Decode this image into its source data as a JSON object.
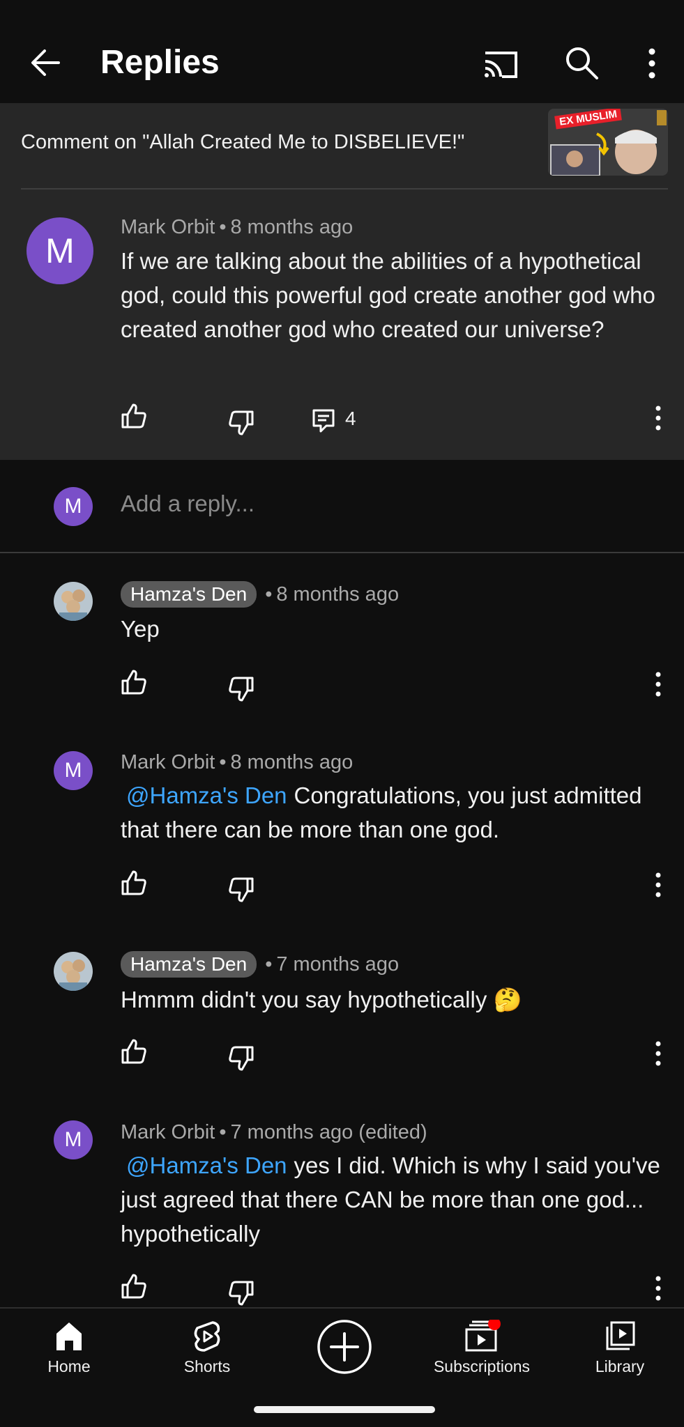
{
  "header": {
    "title": "Replies"
  },
  "context": {
    "comment_on": "Comment on \"Allah Created Me to DISBELIEVE!\"",
    "thumbnail_badge": "EX MUSLIM"
  },
  "main_comment": {
    "avatar_letter": "M",
    "author": "Mark Orbit",
    "time": "8 months ago",
    "text": "If we are talking about the abilities of a hypothetical god, could this powerful god create another god who created another god who created our universe?",
    "reply_count": "4"
  },
  "reply_box": {
    "avatar_letter": "M",
    "placeholder": "Add a reply..."
  },
  "replies": [
    {
      "author": "Hamza's Den",
      "time": "8 months ago",
      "text": "Yep"
    },
    {
      "avatar_letter": "M",
      "author": "Mark Orbit",
      "time": "8 months ago",
      "mention": "@Hamza's Den",
      "text": "Congratulations, you just admitted that there can be more than one god."
    },
    {
      "author": "Hamza's Den",
      "time": "7 months ago",
      "text": "Hmmm didn't you say hypothetically 🤔"
    },
    {
      "avatar_letter": "M",
      "author": "Mark Orbit",
      "time": "7 months ago (edited)",
      "mention": "@Hamza's Den",
      "text": "yes I did. Which is why I said you've just agreed that there CAN be more than one god... hypothetically"
    }
  ],
  "separator": "•",
  "bottom_nav": {
    "home": "Home",
    "shorts": "Shorts",
    "subscriptions": "Subscriptions",
    "library": "Library"
  },
  "colors": {
    "avatar": "#7a4fc8",
    "mention": "#3ea6ff",
    "notification_dot": "#ff0000"
  }
}
